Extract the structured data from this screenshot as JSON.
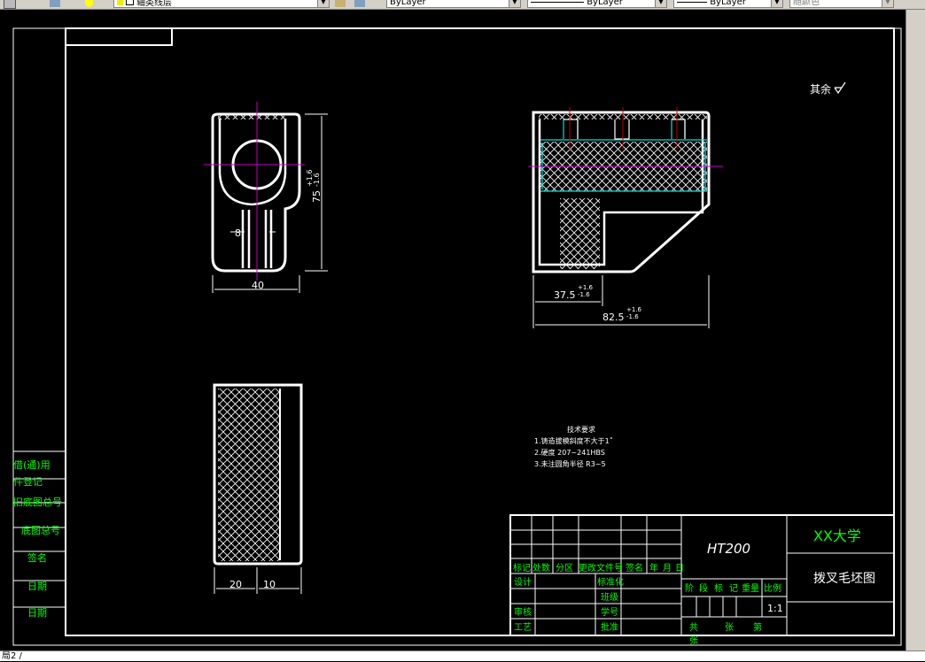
{
  "toolbar": {
    "layer_name": "轴类线层",
    "color": "ByLayer",
    "linetype": "ByLayer",
    "lineweight": "ByLayer",
    "plotstyle": "随颜色"
  },
  "drawing": {
    "surface_finish_note": "其余",
    "dims": {
      "d8": "8",
      "d40": "40",
      "d75": "75",
      "d37_5": "37.5",
      "d82_5": "82.5",
      "tol_plus": "+1.6",
      "tol_minus": "-1.6",
      "d20": "20",
      "d10": "10"
    },
    "tech_req": {
      "title": "技术要求",
      "items": [
        "1.铸造拔模斜度不大于1˚",
        "2.硬度 207~241HBS",
        "3.未注圆角半径 R3~5"
      ]
    },
    "side_table": [
      "借(通)用",
      "件登记",
      "旧底图总号",
      "底图总号",
      "签名",
      "日期",
      "日期"
    ],
    "title_block": {
      "material": "HT200",
      "org": "XX大学",
      "drawing_name": "拨叉毛坯图",
      "rev_headers": [
        "标记",
        "处数",
        "分区",
        "更改文件号",
        "签名",
        "年",
        "月",
        "日"
      ],
      "sign_left": [
        "设计",
        "审核",
        "工艺"
      ],
      "sign_mid": [
        "标准化",
        "班级",
        "学号",
        "批准"
      ],
      "stage_headers": [
        "阶",
        "段",
        "标",
        "记",
        "重量",
        "比例"
      ],
      "scale": "1:1",
      "sheet_text": [
        "共",
        "张",
        "第",
        "张"
      ]
    }
  },
  "command_line": "局2 /"
}
